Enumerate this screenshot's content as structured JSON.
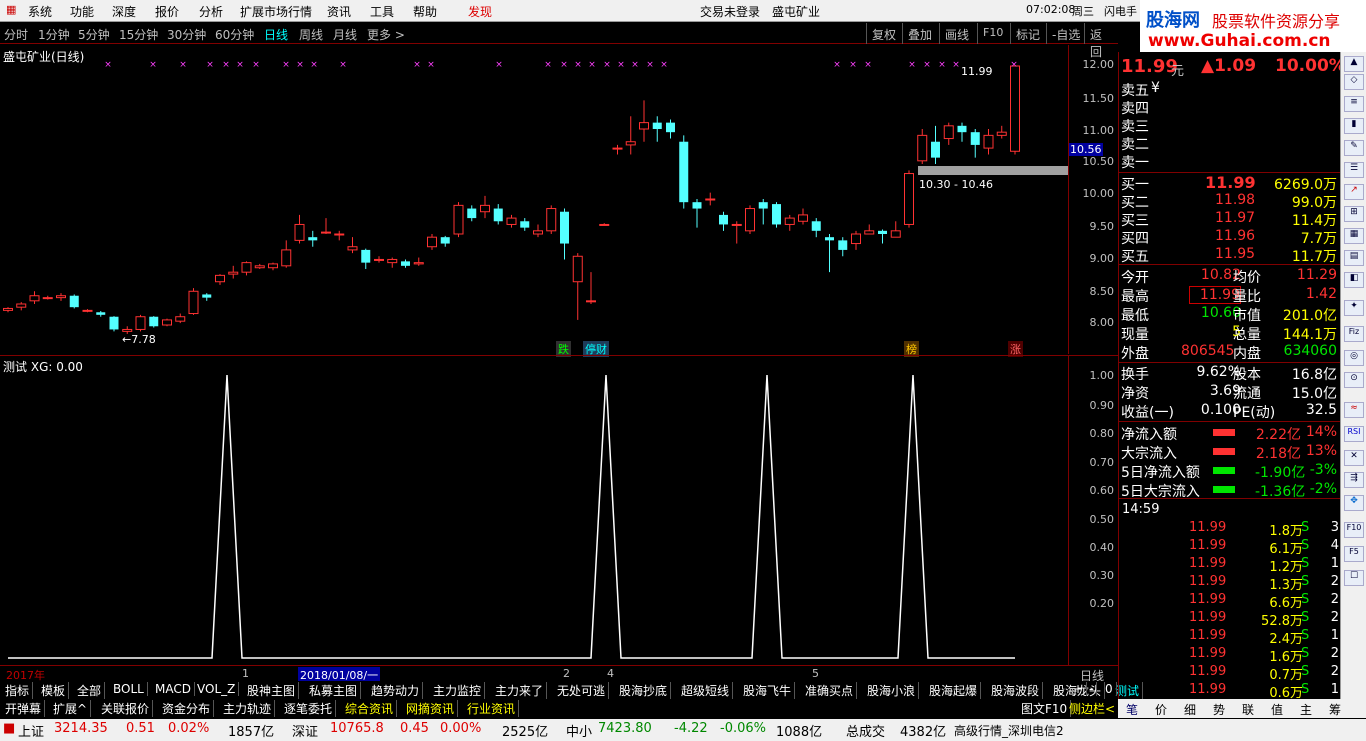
{
  "menubar": {
    "items": [
      "系统",
      "功能",
      "深度",
      "报价",
      "分析",
      "扩展市场行情",
      "资讯",
      "工具",
      "帮助"
    ],
    "discover": "发现",
    "login_status": "交易未登录",
    "stock_title": "盛屯矿业",
    "time": "07:02:08",
    "weekday": "周三",
    "flash": "闪电手"
  },
  "logo": {
    "name": "股海网",
    "slogan": "股票软件资源分享",
    "url": "www.Guhai.com.cn"
  },
  "periods": {
    "items": [
      "分时",
      "1分钟",
      "5分钟",
      "15分钟",
      "30分钟",
      "60分钟",
      "日线",
      "周线",
      "月线",
      "更多 >"
    ],
    "active": "日线",
    "tools": [
      "复权",
      "叠加",
      "画线",
      "F10",
      "标记",
      "-自选",
      "返回"
    ]
  },
  "main_chart": {
    "title": "盛屯矿业(日线)",
    "last_label": "11.99",
    "low_label": "7.78",
    "price_marker": "10.56",
    "zone_label": "10.30 - 10.46",
    "y_ticks": [
      "12.00",
      "11.50",
      "11.00",
      "10.50",
      "10.00",
      "9.50",
      "9.00",
      "8.50",
      "8.00"
    ],
    "event_tags": [
      "跌",
      "停财",
      "榜",
      "涨"
    ]
  },
  "indicator": {
    "title": "测试",
    "value_label": "XG: 0.00",
    "y_ticks": [
      "1.00",
      "0.90",
      "0.80",
      "0.70",
      "0.60",
      "0.50",
      "0.40",
      "0.30",
      "0.20"
    ]
  },
  "time_axis": {
    "year": "2017年",
    "labels": [
      "1",
      "2018/01/08/一",
      "2",
      "4",
      "5"
    ],
    "period": "日线"
  },
  "tabs1": [
    "指标",
    "模板",
    "全部",
    "BOLL",
    "MACD",
    "VOL_Z",
    "股神主图",
    "私募主图",
    "趋势动力",
    "主力监控",
    "主力来了",
    "无处可逃",
    "股海抄底",
    "超级短线",
    "股海飞牛",
    "准确买点",
    "股海小浪",
    "股海起爆",
    "股海波段",
    "股海龙头",
    "测试"
  ],
  "tabs1_controls": [
    "+",
    "-",
    "0"
  ],
  "tabs2": [
    "开弹幕",
    "扩展^",
    "关联报价",
    "资金分布",
    "主力轨迹",
    "逐笔委托",
    "综合资讯",
    "网摘资讯",
    "行业资讯"
  ],
  "tabs2_right": [
    "图文F10",
    "侧边栏<"
  ],
  "quote": {
    "price": "11.99",
    "unit": "元",
    "change": "▲1.09",
    "pct": "10.00%",
    "asks": [
      {
        "label": "卖五",
        "extra": "¥"
      },
      {
        "label": "卖四",
        "extra": ""
      },
      {
        "label": "卖三",
        "extra": ""
      },
      {
        "label": "卖二",
        "extra": ""
      },
      {
        "label": "卖一",
        "extra": ""
      }
    ],
    "bids": [
      {
        "label": "买一",
        "price": "11.99",
        "vol": "6269.0万"
      },
      {
        "label": "买二",
        "price": "11.98",
        "vol": "99.0万"
      },
      {
        "label": "买三",
        "price": "11.97",
        "vol": "11.4万"
      },
      {
        "label": "买四",
        "price": "11.96",
        "vol": "7.7万"
      },
      {
        "label": "买五",
        "price": "11.95",
        "vol": "11.7万"
      }
    ],
    "stats": [
      {
        "l1": "今开",
        "v1": "10.82",
        "l2": "均价",
        "v2": "11.29"
      },
      {
        "l1": "最高",
        "v1": "11.99",
        "l2": "量比",
        "v2": "1.42"
      },
      {
        "l1": "最低",
        "v1": "10.60",
        "l2": "市值",
        "v2": "201.0亿"
      },
      {
        "l1": "现量",
        "v1": "5",
        "l2": "总量",
        "v2": "144.1万"
      },
      {
        "l1": "外盘",
        "v1": "806545",
        "l2": "内盘",
        "v2": "634060"
      }
    ],
    "stats2": [
      {
        "l1": "换手",
        "v1": "9.62%",
        "l2": "股本",
        "v2": "16.8亿"
      },
      {
        "l1": "净资",
        "v1": "3.69",
        "l2": "流通",
        "v2": "15.0亿"
      },
      {
        "l1": "收益(一)",
        "v1": "0.100",
        "l2": "PE(动)",
        "v2": "32.5"
      }
    ],
    "flows": [
      {
        "label": "净流入额",
        "value": "2.22亿",
        "pct": "14%",
        "dir": "up"
      },
      {
        "label": "大宗流入",
        "value": "2.18亿",
        "pct": "13%",
        "dir": "up"
      },
      {
        "label": "5日净流入额",
        "value": "-1.90亿",
        "pct": "-3%",
        "dir": "down"
      },
      {
        "label": "5日大宗流入",
        "value": "-1.36亿",
        "pct": "-2%",
        "dir": "down"
      }
    ],
    "ticks_time": "14:59",
    "ticks": [
      {
        "p": "11.99",
        "v": "1.8万",
        "s": "S",
        "n": "3"
      },
      {
        "p": "11.99",
        "v": "6.1万",
        "s": "S",
        "n": "4"
      },
      {
        "p": "11.99",
        "v": "1.2万",
        "s": "S",
        "n": "1"
      },
      {
        "p": "11.99",
        "v": "1.3万",
        "s": "S",
        "n": "2"
      },
      {
        "p": "11.99",
        "v": "6.6万",
        "s": "S",
        "n": "2"
      },
      {
        "p": "11.99",
        "v": "52.8万",
        "s": "S",
        "n": "2"
      },
      {
        "p": "11.99",
        "v": "2.4万",
        "s": "S",
        "n": "1"
      },
      {
        "p": "11.99",
        "v": "1.6万",
        "s": "S",
        "n": "2"
      },
      {
        "p": "11.99",
        "v": "0.7万",
        "s": "S",
        "n": "2"
      },
      {
        "p": "11.99",
        "v": "0.6万",
        "s": "S",
        "n": "1"
      }
    ]
  },
  "bottom_tabs": [
    "笔",
    "价",
    "细",
    "势",
    "联",
    "值",
    "主",
    "筹"
  ],
  "statusbar": {
    "items": [
      {
        "name": "上证",
        "price": "3214.35",
        "chg": "0.51",
        "pct": "0.02%",
        "amt": "1857亿"
      },
      {
        "name": "深证",
        "price": "10765.8",
        "chg": "0.45",
        "pct": "0.00%",
        "amt": "2525亿"
      },
      {
        "name": "中小",
        "price": "7423.80",
        "chg": "-4.22",
        "pct": "-0.06%",
        "amt": "1088亿"
      }
    ],
    "total_label": "总成交",
    "total": "4382亿",
    "feed": "高级行情_深圳电信2"
  },
  "sidebar_icons": [
    "RSI",
    "F10",
    "F5",
    "Fiz"
  ],
  "chart_data": {
    "type": "candlestick",
    "ylim": [
      7.7,
      12.1
    ],
    "candles": [
      [
        8.15,
        8.18,
        8.12,
        8.2
      ],
      [
        8.2,
        8.25,
        8.15,
        8.28
      ],
      [
        8.3,
        8.38,
        8.25,
        8.45
      ],
      [
        8.35,
        8.35,
        8.32,
        8.38
      ],
      [
        8.35,
        8.38,
        8.3,
        8.42
      ],
      [
        8.38,
        8.2,
        8.18,
        8.4
      ],
      [
        8.15,
        8.15,
        8.12,
        8.17
      ],
      [
        8.12,
        8.08,
        8.05,
        8.14
      ],
      [
        8.05,
        7.85,
        7.82,
        8.06
      ],
      [
        7.82,
        7.85,
        7.78,
        7.9
      ],
      [
        7.85,
        8.05,
        7.82,
        8.08
      ],
      [
        8.05,
        7.9,
        7.88,
        8.06
      ],
      [
        7.92,
        8.0,
        7.9,
        8.02
      ],
      [
        7.98,
        8.05,
        7.95,
        8.1
      ],
      [
        8.1,
        8.45,
        8.08,
        8.5
      ],
      [
        8.4,
        8.35,
        8.3,
        8.42
      ],
      [
        8.6,
        8.7,
        8.55,
        8.72
      ],
      [
        8.72,
        8.75,
        8.65,
        8.85
      ],
      [
        8.75,
        8.9,
        8.7,
        8.92
      ],
      [
        8.82,
        8.85,
        8.8,
        8.88
      ],
      [
        8.82,
        8.88,
        8.78,
        8.9
      ],
      [
        8.85,
        9.1,
        8.82,
        9.25
      ],
      [
        9.25,
        9.5,
        9.2,
        9.65
      ],
      [
        9.3,
        9.25,
        9.15,
        9.4
      ],
      [
        9.38,
        9.38,
        9.35,
        9.6
      ],
      [
        9.35,
        9.35,
        9.25,
        9.4
      ],
      [
        9.1,
        9.15,
        9.05,
        9.3
      ],
      [
        9.1,
        8.9,
        8.8,
        9.12
      ],
      [
        8.95,
        8.95,
        8.9,
        9.0
      ],
      [
        8.9,
        8.95,
        8.82,
        8.98
      ],
      [
        8.92,
        8.85,
        8.82,
        8.95
      ],
      [
        8.88,
        8.9,
        8.85,
        8.98
      ],
      [
        9.15,
        9.3,
        9.1,
        9.35
      ],
      [
        9.3,
        9.2,
        9.15,
        9.32
      ],
      [
        9.35,
        9.8,
        9.3,
        9.85
      ],
      [
        9.75,
        9.6,
        9.55,
        9.8
      ],
      [
        9.7,
        9.8,
        9.6,
        9.95
      ],
      [
        9.75,
        9.55,
        9.5,
        9.82
      ],
      [
        9.5,
        9.6,
        9.45,
        9.65
      ],
      [
        9.55,
        9.45,
        9.4,
        9.6
      ],
      [
        9.35,
        9.4,
        9.3,
        9.5
      ],
      [
        9.4,
        9.75,
        9.35,
        9.8
      ],
      [
        9.7,
        9.2,
        8.95,
        9.75
      ],
      [
        8.6,
        9.0,
        8.0,
        9.05
      ],
      [
        8.3,
        8.3,
        8.25,
        8.75
      ],
      [
        9.5,
        9.5,
        9.5,
        9.52
      ],
      [
        10.7,
        10.7,
        10.6,
        10.75
      ],
      [
        10.75,
        10.8,
        10.6,
        11.2
      ],
      [
        11.0,
        11.1,
        10.8,
        11.45
      ],
      [
        11.1,
        11.0,
        10.8,
        11.2
      ],
      [
        11.1,
        10.95,
        10.85,
        11.15
      ],
      [
        10.8,
        9.85,
        9.75,
        10.9
      ],
      [
        9.85,
        9.75,
        9.45,
        9.9
      ],
      [
        9.9,
        9.9,
        9.8,
        10.0
      ],
      [
        9.65,
        9.5,
        9.4,
        9.7
      ],
      [
        9.5,
        9.5,
        9.2,
        9.55
      ],
      [
        9.4,
        9.75,
        9.35,
        9.8
      ],
      [
        9.85,
        9.75,
        9.5,
        9.9
      ],
      [
        9.82,
        9.5,
        9.45,
        9.85
      ],
      [
        9.5,
        9.6,
        9.4,
        9.65
      ],
      [
        9.55,
        9.65,
        9.5,
        9.75
      ],
      [
        9.55,
        9.4,
        9.3,
        9.6
      ],
      [
        9.3,
        9.25,
        8.75,
        9.35
      ],
      [
        9.25,
        9.1,
        9.0,
        9.3
      ],
      [
        9.2,
        9.35,
        9.1,
        9.4
      ],
      [
        9.35,
        9.4,
        9.35,
        9.5
      ],
      [
        9.4,
        9.35,
        9.2,
        9.42
      ],
      [
        9.3,
        9.4,
        9.3,
        9.55
      ],
      [
        9.5,
        10.3,
        9.45,
        10.35
      ],
      [
        10.5,
        10.9,
        10.45,
        11.0
      ],
      [
        10.8,
        10.55,
        10.45,
        11.05
      ],
      [
        10.85,
        11.05,
        10.75,
        11.1
      ],
      [
        11.05,
        10.95,
        10.8,
        11.1
      ],
      [
        10.95,
        10.75,
        10.55,
        11.0
      ],
      [
        10.7,
        10.9,
        10.6,
        11.0
      ],
      [
        10.9,
        10.95,
        10.85,
        11.05
      ],
      [
        10.65,
        11.99,
        10.6,
        11.99
      ]
    ],
    "indicator_series": [
      0,
      1,
      0,
      1,
      0,
      1,
      0,
      1,
      0
    ],
    "indicator_ylim": [
      0,
      1
    ]
  }
}
